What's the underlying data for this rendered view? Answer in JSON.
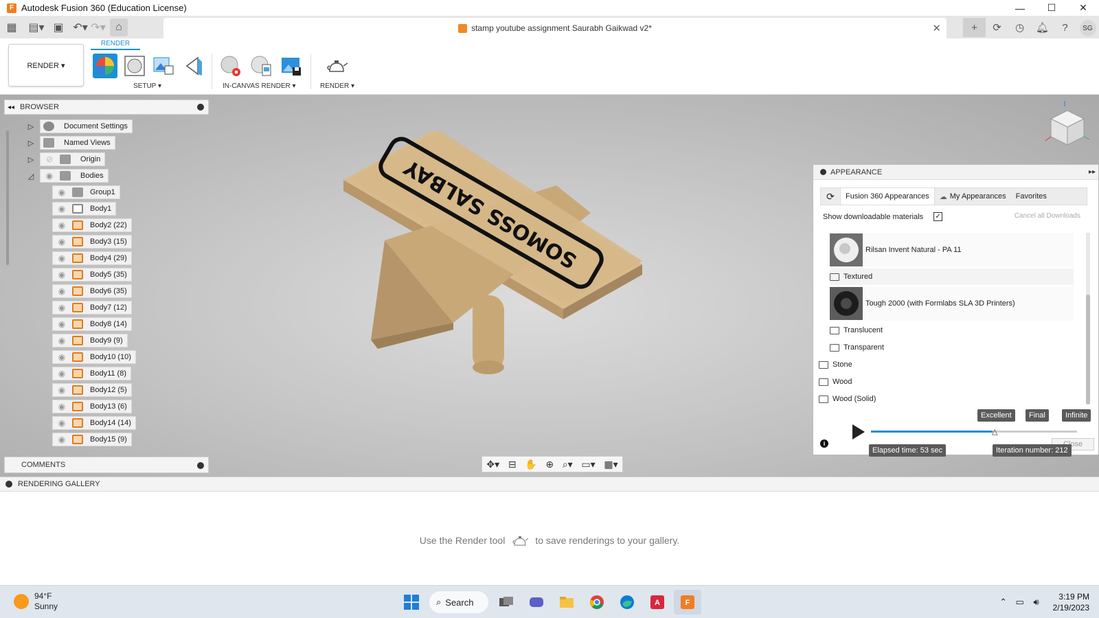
{
  "window": {
    "title": "Autodesk Fusion 360 (Education License)",
    "minimize": "—",
    "maximize": "☐",
    "close": "✕"
  },
  "document_tab": {
    "title": "stamp youtube assignment Saurabh Gaikwad v2*",
    "close": "✕"
  },
  "user": {
    "initials": "SG"
  },
  "toolbar": {
    "workspace_label": "RENDER ▾",
    "active_tab": "RENDER",
    "groups": {
      "setup": "SETUP ▾",
      "in_canvas_render": "IN-CANVAS RENDER ▾",
      "render": "RENDER ▾"
    }
  },
  "browser": {
    "header": "BROWSER",
    "items": [
      {
        "label": "Document Settings",
        "icon": "gear-icon"
      },
      {
        "label": "Named Views",
        "icon": "folder-icon"
      },
      {
        "label": "Origin",
        "icon": "folder-icon"
      },
      {
        "label": "Bodies",
        "icon": "folder-icon"
      }
    ],
    "bodies": [
      {
        "label": "Group1",
        "icon": "folder-icon"
      },
      {
        "label": "Body1",
        "icon": "body-icon"
      },
      {
        "label": "Body2 (22)",
        "icon": "body-icon"
      },
      {
        "label": "Body3 (15)",
        "icon": "body-icon"
      },
      {
        "label": "Body4 (29)",
        "icon": "body-icon"
      },
      {
        "label": "Body5 (35)",
        "icon": "body-icon"
      },
      {
        "label": "Body6 (35)",
        "icon": "body-icon"
      },
      {
        "label": "Body7 (12)",
        "icon": "body-icon"
      },
      {
        "label": "Body8 (14)",
        "icon": "body-icon"
      },
      {
        "label": "Body9 (9)",
        "icon": "body-icon"
      },
      {
        "label": "Body10 (10)",
        "icon": "body-icon"
      },
      {
        "label": "Body11 (8)",
        "icon": "body-icon"
      },
      {
        "label": "Body12 (5)",
        "icon": "body-icon"
      },
      {
        "label": "Body13 (6)",
        "icon": "body-icon"
      },
      {
        "label": "Body14 (14)",
        "icon": "body-icon"
      },
      {
        "label": "Body15 (9)",
        "icon": "body-icon"
      }
    ]
  },
  "comments": {
    "header": "COMMENTS"
  },
  "model": {
    "stamp_text": "SOMOSS SALBAY"
  },
  "appearance": {
    "header": "APPEARANCE",
    "tabs": [
      "Fusion 360 Appearances",
      "My Appearances",
      "Favorites"
    ],
    "show_downloadable": "Show downloadable materials",
    "show_downloadable_checked": true,
    "cancel_downloads": "Cancel all Downloads",
    "materials": [
      {
        "label": "Rilsan Invent Natural - PA 11",
        "type": "material"
      },
      {
        "label": "Textured",
        "type": "folder"
      },
      {
        "label": "Tough 2000 (with Formlabs SLA 3D Printers)",
        "type": "material"
      },
      {
        "label": "Translucent",
        "type": "folder"
      },
      {
        "label": "Transparent",
        "type": "folder"
      },
      {
        "label": "Stone",
        "type": "folder"
      },
      {
        "label": "Wood",
        "type": "folder"
      },
      {
        "label": "Wood (Solid)",
        "type": "folder"
      }
    ]
  },
  "render_progress": {
    "quality_labels": [
      "Excellent",
      "Final",
      "Infinite"
    ],
    "elapsed": "Elapsed time: 53 sec",
    "iteration": "Iteration number: 212",
    "close": "Close",
    "progress_fraction": 0.59
  },
  "gallery": {
    "header": "RENDERING GALLERY",
    "message_before": "Use the Render tool",
    "message_after": "to save renderings to your gallery."
  },
  "taskbar": {
    "temperature": "94°F",
    "condition": "Sunny",
    "search": "Search",
    "time": "3:19 PM",
    "date": "2/19/2023"
  },
  "colors": {
    "accent": "#1b8fd6",
    "model_tan": "#c9a878",
    "body_icon": "#e07a1e"
  }
}
